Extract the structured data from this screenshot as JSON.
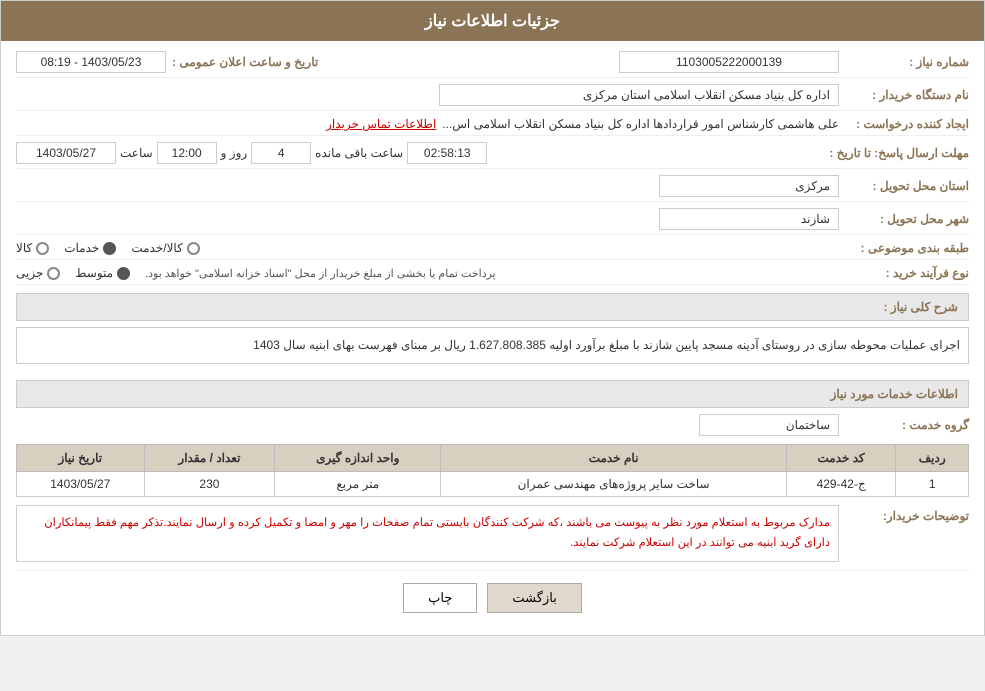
{
  "header": {
    "title": "جزئیات اطلاعات نیاز"
  },
  "fields": {
    "shomareNiaz_label": "شماره نیاز :",
    "shomareNiaz_value": "1103005222000139",
    "namdastgah_label": "نام دستگاه خریدار :",
    "namdastgah_value": "اداره کل بنیاد مسکن انقلاب اسلامی استان مرکزی",
    "ijadKonande_label": "ایجاد کننده درخواست :",
    "ijadKonande_value": "علی هاشمی کارشناس امور قراردادها اداره کل بنیاد مسکن انقلاب اسلامی اس...",
    "contact_link": "اطلاعات تماس خریدار",
    "mohlat_label": "مهلت ارسال پاسخ: تا تاریخ :",
    "date_value": "1403/05/27",
    "time_label": "ساعت",
    "time_value": "12:00",
    "days_label": "روز و",
    "days_value": "4",
    "remaining_label": "ساعت باقی مانده",
    "remaining_value": "02:58:13",
    "ostanTahvil_label": "استان محل تحویل :",
    "ostanTahvil_value": "مرکزی",
    "shahrTahvil_label": "شهر محل تحویل :",
    "shahrTahvil_value": "شازند",
    "tabaqehBandii_label": "طبقه بندی موضوعی :",
    "radio_kala": "کالا",
    "radio_khadamat": "خدمات",
    "radio_kala_khadamat": "کالا/خدمت",
    "radio_khadamat_selected": true,
    "noefarayand_label": "نوع فرآیند خرید :",
    "process_jozii": "جزیی",
    "process_motavaset": "متوسط",
    "process_note": "پرداخت تمام یا بخشی از مبلغ خریدار از محل \"اسناد خزانه اسلامی\" خواهد بود.",
    "tarikh_label": "تاریخ و ساعت اعلان عمومی :",
    "tarikh_aelan": "1403/05/23 - 08:19"
  },
  "sharh_section": {
    "title": "شرح کلی نیاز :",
    "text": "اجرای عملیات محوطه سازی در روستای آدینه مسجد پایین شازند با مبلغ برآورد اولیه   1.627.808.385  ریال بر مبنای فهرست بهای ابنیه سال 1403"
  },
  "service_section": {
    "title": "اطلاعات خدمات مورد نیاز",
    "group_label": "گروه خدمت :",
    "group_value": "ساختمان",
    "table": {
      "headers": [
        "ردیف",
        "کد خدمت",
        "نام خدمت",
        "واحد اندازه گیری",
        "تعداد / مقدار",
        "تاریخ نیاز"
      ],
      "rows": [
        {
          "radif": "1",
          "kod": "ج-42-429",
          "name": "ساخت سایر پروژه‌های مهندسی عمران",
          "vahed": "متر مربع",
          "tedad": "230",
          "tarikh": "1403/05/27"
        }
      ]
    }
  },
  "buyer_notes": {
    "label": "توضیحات خریدار:",
    "text": "مدارک مربوط به استعلام مورد نظر به پیوست می باشند ،که شرکت کنندگان بایستی تمام صفحات را مهر و امضا و تکمیل کرده و ارسال نمایند.تذکر مهم فقط پیمانکاران دارای گرید ابنیه می توانند در این استعلام شرکت نمایند."
  },
  "buttons": {
    "print": "چاپ",
    "back": "بازگشت"
  }
}
